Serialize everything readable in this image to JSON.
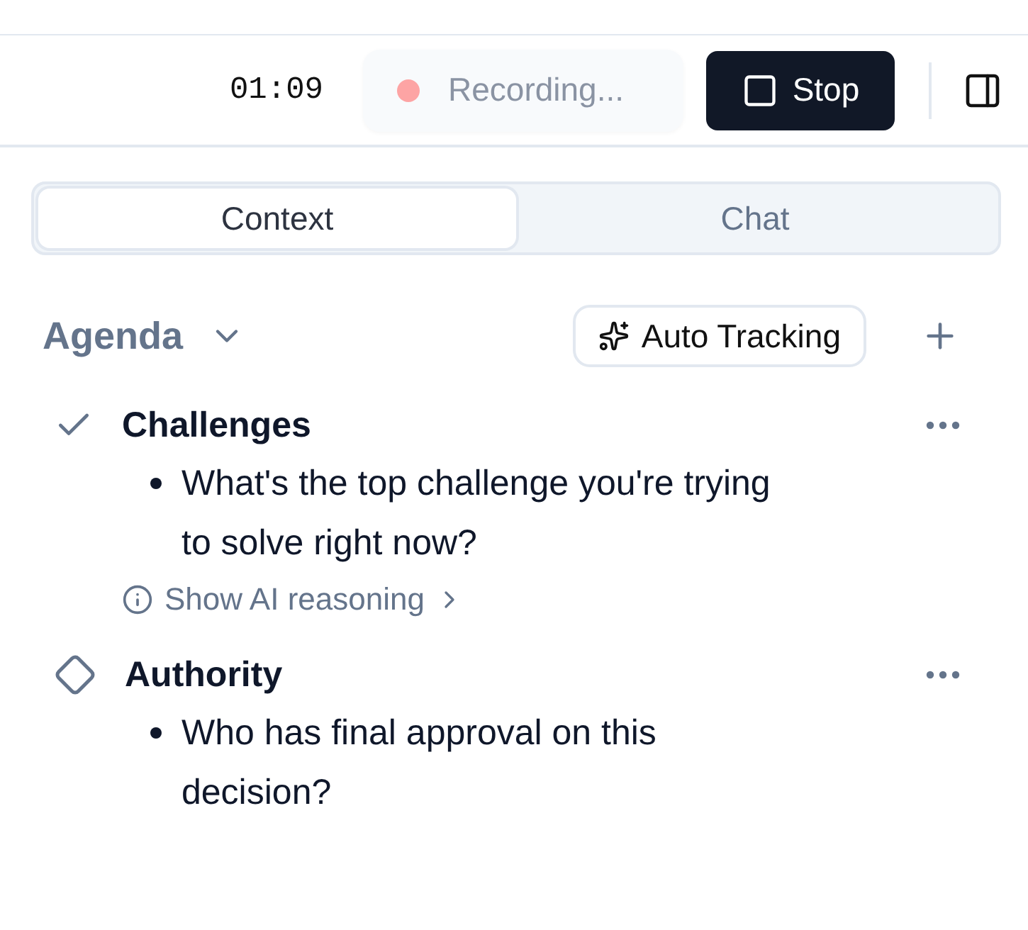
{
  "header": {
    "timer": "01:09",
    "recording": {
      "label": "Recording...",
      "active": true
    },
    "stop_button": "Stop"
  },
  "tabs": [
    {
      "label": "Context",
      "selected": true
    },
    {
      "label": "Chat",
      "selected": false
    }
  ],
  "agenda": {
    "title": "Agenda",
    "expanded": true,
    "auto_tracking": "Auto Tracking",
    "items": [
      {
        "title": "Challenges",
        "completed": true,
        "questions": [
          "What's the top challenge you're trying to solve right now?"
        ],
        "reasoning_link": "Show AI reasoning"
      },
      {
        "title": "Authority",
        "completed": false,
        "questions": [
          "Who has final approval on this decision?"
        ]
      }
    ]
  }
}
